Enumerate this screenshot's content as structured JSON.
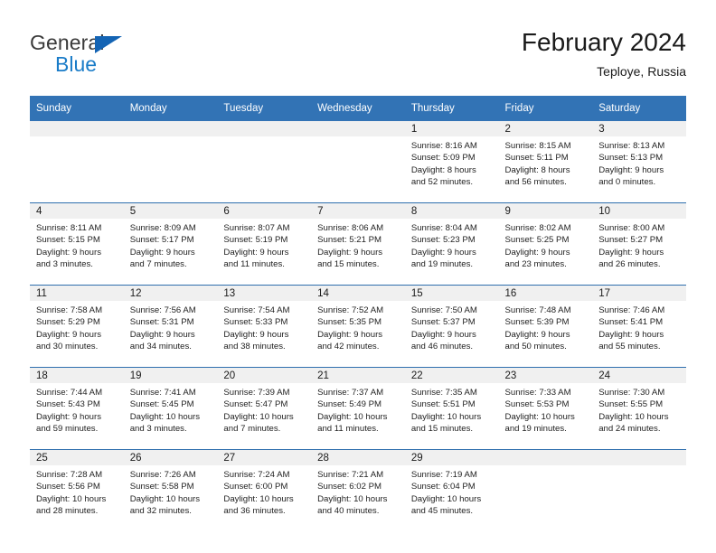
{
  "brand": {
    "name_top": "General",
    "name_bottom": "Blue",
    "triangle_color": "#1464b4",
    "blue_color": "#1a7cc8"
  },
  "header": {
    "title": "February 2024",
    "location": "Teploye, Russia"
  },
  "theme": {
    "header_blue": "#3273b5",
    "grid_line": "#2f6fae",
    "daynum_band": "#f0f0f0"
  },
  "weekdays": [
    "Sunday",
    "Monday",
    "Tuesday",
    "Wednesday",
    "Thursday",
    "Friday",
    "Saturday"
  ],
  "weeks": [
    [
      {
        "day": "",
        "lines": []
      },
      {
        "day": "",
        "lines": []
      },
      {
        "day": "",
        "lines": []
      },
      {
        "day": "",
        "lines": []
      },
      {
        "day": "1",
        "lines": [
          "Sunrise: 8:16 AM",
          "Sunset: 5:09 PM",
          "Daylight: 8 hours",
          "and 52 minutes."
        ]
      },
      {
        "day": "2",
        "lines": [
          "Sunrise: 8:15 AM",
          "Sunset: 5:11 PM",
          "Daylight: 8 hours",
          "and 56 minutes."
        ]
      },
      {
        "day": "3",
        "lines": [
          "Sunrise: 8:13 AM",
          "Sunset: 5:13 PM",
          "Daylight: 9 hours",
          "and 0 minutes."
        ]
      }
    ],
    [
      {
        "day": "4",
        "lines": [
          "Sunrise: 8:11 AM",
          "Sunset: 5:15 PM",
          "Daylight: 9 hours",
          "and 3 minutes."
        ]
      },
      {
        "day": "5",
        "lines": [
          "Sunrise: 8:09 AM",
          "Sunset: 5:17 PM",
          "Daylight: 9 hours",
          "and 7 minutes."
        ]
      },
      {
        "day": "6",
        "lines": [
          "Sunrise: 8:07 AM",
          "Sunset: 5:19 PM",
          "Daylight: 9 hours",
          "and 11 minutes."
        ]
      },
      {
        "day": "7",
        "lines": [
          "Sunrise: 8:06 AM",
          "Sunset: 5:21 PM",
          "Daylight: 9 hours",
          "and 15 minutes."
        ]
      },
      {
        "day": "8",
        "lines": [
          "Sunrise: 8:04 AM",
          "Sunset: 5:23 PM",
          "Daylight: 9 hours",
          "and 19 minutes."
        ]
      },
      {
        "day": "9",
        "lines": [
          "Sunrise: 8:02 AM",
          "Sunset: 5:25 PM",
          "Daylight: 9 hours",
          "and 23 minutes."
        ]
      },
      {
        "day": "10",
        "lines": [
          "Sunrise: 8:00 AM",
          "Sunset: 5:27 PM",
          "Daylight: 9 hours",
          "and 26 minutes."
        ]
      }
    ],
    [
      {
        "day": "11",
        "lines": [
          "Sunrise: 7:58 AM",
          "Sunset: 5:29 PM",
          "Daylight: 9 hours",
          "and 30 minutes."
        ]
      },
      {
        "day": "12",
        "lines": [
          "Sunrise: 7:56 AM",
          "Sunset: 5:31 PM",
          "Daylight: 9 hours",
          "and 34 minutes."
        ]
      },
      {
        "day": "13",
        "lines": [
          "Sunrise: 7:54 AM",
          "Sunset: 5:33 PM",
          "Daylight: 9 hours",
          "and 38 minutes."
        ]
      },
      {
        "day": "14",
        "lines": [
          "Sunrise: 7:52 AM",
          "Sunset: 5:35 PM",
          "Daylight: 9 hours",
          "and 42 minutes."
        ]
      },
      {
        "day": "15",
        "lines": [
          "Sunrise: 7:50 AM",
          "Sunset: 5:37 PM",
          "Daylight: 9 hours",
          "and 46 minutes."
        ]
      },
      {
        "day": "16",
        "lines": [
          "Sunrise: 7:48 AM",
          "Sunset: 5:39 PM",
          "Daylight: 9 hours",
          "and 50 minutes."
        ]
      },
      {
        "day": "17",
        "lines": [
          "Sunrise: 7:46 AM",
          "Sunset: 5:41 PM",
          "Daylight: 9 hours",
          "and 55 minutes."
        ]
      }
    ],
    [
      {
        "day": "18",
        "lines": [
          "Sunrise: 7:44 AM",
          "Sunset: 5:43 PM",
          "Daylight: 9 hours",
          "and 59 minutes."
        ]
      },
      {
        "day": "19",
        "lines": [
          "Sunrise: 7:41 AM",
          "Sunset: 5:45 PM",
          "Daylight: 10 hours",
          "and 3 minutes."
        ]
      },
      {
        "day": "20",
        "lines": [
          "Sunrise: 7:39 AM",
          "Sunset: 5:47 PM",
          "Daylight: 10 hours",
          "and 7 minutes."
        ]
      },
      {
        "day": "21",
        "lines": [
          "Sunrise: 7:37 AM",
          "Sunset: 5:49 PM",
          "Daylight: 10 hours",
          "and 11 minutes."
        ]
      },
      {
        "day": "22",
        "lines": [
          "Sunrise: 7:35 AM",
          "Sunset: 5:51 PM",
          "Daylight: 10 hours",
          "and 15 minutes."
        ]
      },
      {
        "day": "23",
        "lines": [
          "Sunrise: 7:33 AM",
          "Sunset: 5:53 PM",
          "Daylight: 10 hours",
          "and 19 minutes."
        ]
      },
      {
        "day": "24",
        "lines": [
          "Sunrise: 7:30 AM",
          "Sunset: 5:55 PM",
          "Daylight: 10 hours",
          "and 24 minutes."
        ]
      }
    ],
    [
      {
        "day": "25",
        "lines": [
          "Sunrise: 7:28 AM",
          "Sunset: 5:56 PM",
          "Daylight: 10 hours",
          "and 28 minutes."
        ]
      },
      {
        "day": "26",
        "lines": [
          "Sunrise: 7:26 AM",
          "Sunset: 5:58 PM",
          "Daylight: 10 hours",
          "and 32 minutes."
        ]
      },
      {
        "day": "27",
        "lines": [
          "Sunrise: 7:24 AM",
          "Sunset: 6:00 PM",
          "Daylight: 10 hours",
          "and 36 minutes."
        ]
      },
      {
        "day": "28",
        "lines": [
          "Sunrise: 7:21 AM",
          "Sunset: 6:02 PM",
          "Daylight: 10 hours",
          "and 40 minutes."
        ]
      },
      {
        "day": "29",
        "lines": [
          "Sunrise: 7:19 AM",
          "Sunset: 6:04 PM",
          "Daylight: 10 hours",
          "and 45 minutes."
        ]
      },
      {
        "day": "",
        "lines": []
      },
      {
        "day": "",
        "lines": []
      }
    ]
  ]
}
